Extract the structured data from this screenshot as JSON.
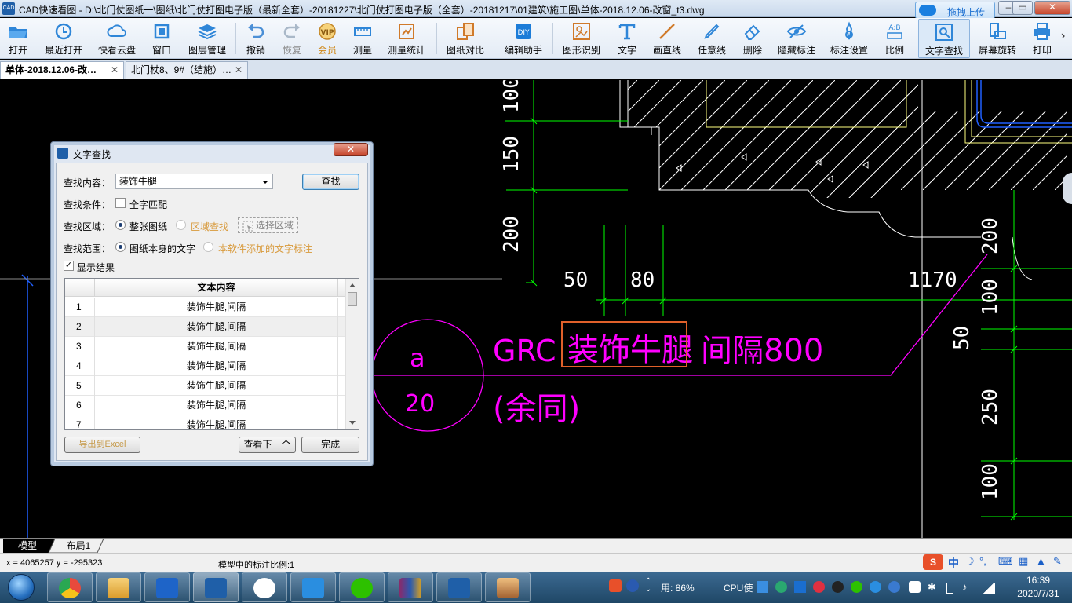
{
  "window": {
    "title": "CAD快速看图 - D:\\北门仗图纸一\\图纸\\北门仗打图电子版（最新全套）-20181227\\北门仗打图电子版（全套）-20181217\\01建筑\\施工图\\单体-2018.12.06-改窗_t3.dwg",
    "upload_label": "拖拽上传",
    "app_icon_text": "CAD"
  },
  "toolbar": {
    "items": [
      {
        "label": "打开",
        "icon": "folder-open-icon"
      },
      {
        "label": "最近打开",
        "icon": "recent-clock-icon"
      },
      {
        "label": "快看云盘",
        "icon": "cloud-icon"
      },
      {
        "label": "窗口",
        "icon": "window-icon"
      },
      {
        "label": "图层管理",
        "icon": "layers-icon"
      },
      {
        "label": "撤销",
        "icon": "undo-icon"
      },
      {
        "label": "恢复",
        "icon": "redo-icon"
      },
      {
        "label": "会员",
        "icon": "vip-icon"
      },
      {
        "label": "测量",
        "icon": "ruler-icon"
      },
      {
        "label": "测量统计",
        "icon": "measure-stats-icon"
      },
      {
        "label": "图纸对比",
        "icon": "compare-icon"
      },
      {
        "label": "编辑助手",
        "icon": "edit-assistant-icon"
      },
      {
        "label": "图形识别",
        "icon": "shape-recognize-icon"
      },
      {
        "label": "文字",
        "icon": "text-icon"
      },
      {
        "label": "画直线",
        "icon": "line-icon"
      },
      {
        "label": "任意线",
        "icon": "pen-icon"
      },
      {
        "label": "删除",
        "icon": "eraser-icon"
      },
      {
        "label": "隐藏标注",
        "icon": "eye-hide-icon"
      },
      {
        "label": "标注设置",
        "icon": "annotation-settings-icon"
      },
      {
        "label": "比例",
        "icon": "scale-icon"
      },
      {
        "label": "文字查找",
        "icon": "text-search-icon"
      },
      {
        "label": "屏幕旋转",
        "icon": "rotate-screen-icon"
      },
      {
        "label": "打印",
        "icon": "printer-icon"
      }
    ],
    "overflow": "›"
  },
  "tabs": [
    {
      "label": "单体-2018.12.06-改…",
      "close": "✕"
    },
    {
      "label": "北门杖8、9#（结施）…",
      "close": "✕"
    }
  ],
  "drawing": {
    "dims": [
      "100",
      "150",
      "200",
      "50",
      "80",
      "1170",
      "200",
      "100",
      "50",
      "250",
      "100"
    ],
    "callout_top": "a",
    "callout_bottom": "20",
    "note_prefix": "GRC",
    "note_highlight": "装饰牛腿",
    "note_suffix": "间隔800",
    "note_line2": "(余同)",
    "colors": {
      "green": "#00ff00",
      "magenta": "#ff00ff",
      "white": "#ffffff",
      "yellow": "#ffff80",
      "blue": "#2060ff",
      "highlight": "#e0602a"
    }
  },
  "dialog": {
    "title": "文字查找",
    "close": "✕",
    "search_label": "查找内容：",
    "search_value": "装饰牛腿",
    "find_button": "查找",
    "condition_label": "查找条件：",
    "full_match": "全字匹配",
    "area_label": "查找区域：",
    "area_whole": "整张图纸",
    "area_region": "区域查找",
    "select_area": "选择区域",
    "range_label": "查找范围：",
    "range_drawing": "图纸本身的文字",
    "range_added": "本软件添加的文字标注",
    "show_results": "显示结果",
    "checked_mark": "✓",
    "table_header": "文本内容",
    "rows": [
      {
        "n": "1",
        "text": "装饰牛腿,间隔"
      },
      {
        "n": "2",
        "text": "装饰牛腿,间隔"
      },
      {
        "n": "3",
        "text": "装饰牛腿,间隔"
      },
      {
        "n": "4",
        "text": "装饰牛腿,间隔"
      },
      {
        "n": "5",
        "text": "装饰牛腿,间隔"
      },
      {
        "n": "6",
        "text": "装饰牛腿,间隔"
      },
      {
        "n": "7",
        "text": "装饰牛腿,间隔"
      }
    ],
    "export_button": "导出到Excel",
    "next_button": "查看下一个",
    "done_button": "完成"
  },
  "layout_tabs": [
    "模型",
    "布局1"
  ],
  "status": {
    "coords": "x = 4065257  y = -295323",
    "scale": "模型中的标注比例:1"
  },
  "ime": {
    "lang": "中"
  },
  "taskbar": {
    "apps": [
      "chrome",
      "explorer",
      "wps-writer",
      "cad-viewer",
      "baidu-netdisk",
      "t-app",
      "wechat",
      "winrar",
      "cad-viewer-2",
      "game"
    ],
    "tray_mem": "用: 86%",
    "tray_cpu": "CPU使",
    "time": "16:39",
    "date": "2020/7/31"
  }
}
